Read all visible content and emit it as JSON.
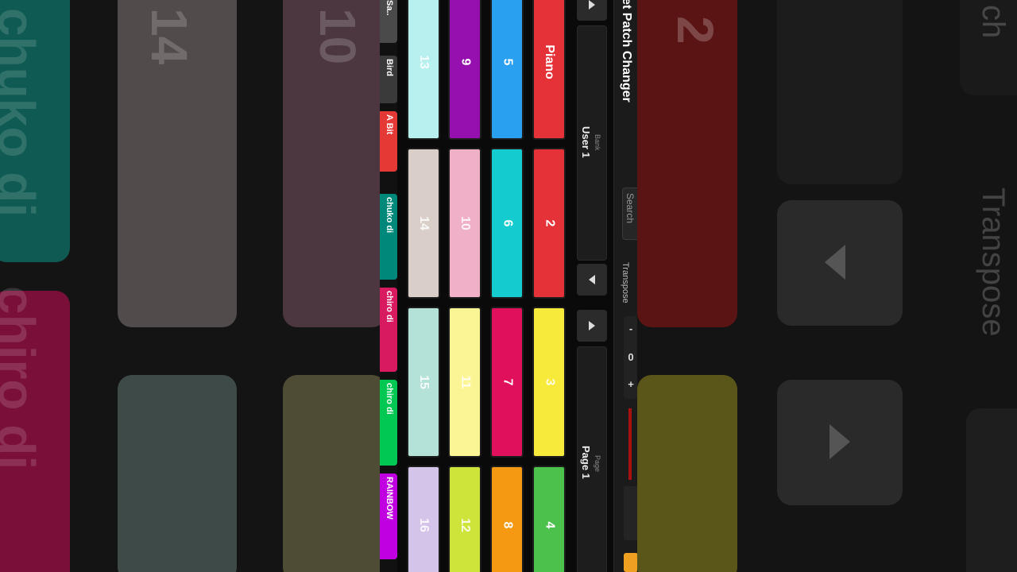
{
  "app": {
    "title": "Live Set Patch Changer"
  },
  "setlist": [
    {
      "label": "Sa..",
      "color": "#4a4a4a"
    },
    {
      "label": "Bird",
      "color": "#3a3a3a"
    },
    {
      "label": "A Bit",
      "color": "#e53935"
    },
    {
      "label": "chuko di",
      "color": "#00897b"
    },
    {
      "label": "chiro di",
      "color": "#d81b60"
    },
    {
      "label": "chiro di",
      "color": "#00c853"
    },
    {
      "label": "RAINBOW",
      "color": "#c000e0"
    }
  ],
  "pads": [
    {
      "label": "Piano",
      "color": "#e53238"
    },
    {
      "label": "2",
      "color": "#e53238"
    },
    {
      "label": "3",
      "color": "#f7ea3a"
    },
    {
      "label": "4",
      "color": "#4cc24c"
    },
    {
      "label": "5",
      "color": "#2aa0f0"
    },
    {
      "label": "6",
      "color": "#14ccd0"
    },
    {
      "label": "7",
      "color": "#e0105c"
    },
    {
      "label": "8",
      "color": "#f59812"
    },
    {
      "label": "9",
      "color": "#9610b0"
    },
    {
      "label": "10",
      "color": "#f0b0c8"
    },
    {
      "label": "11",
      "color": "#fbf596"
    },
    {
      "label": "12",
      "color": "#cfe43a"
    },
    {
      "label": "13",
      "color": "#b8f0f0"
    },
    {
      "label": "14",
      "color": "#d9cec8"
    },
    {
      "label": "15",
      "color": "#b4e2d8"
    },
    {
      "label": "16",
      "color": "#d4c4ea"
    }
  ],
  "bank": {
    "caption": "Bank",
    "value": "User 1"
  },
  "page": {
    "caption": "Page",
    "value": "Page 1"
  },
  "search": {
    "placeholder": "Search"
  },
  "transpose": {
    "label": "Transpose",
    "minus": "-",
    "value": "0",
    "plus": "+"
  },
  "bg_text": {
    "left_pad_a": "14",
    "left_pad_b": "10",
    "left_side_a": "chuko di",
    "left_side_b": "chiro di",
    "right_pad": "2",
    "right_label": "Transpose",
    "right_top": "ch"
  },
  "icons": {
    "next": "triangle-right-icon",
    "prev": "triangle-left-icon"
  }
}
